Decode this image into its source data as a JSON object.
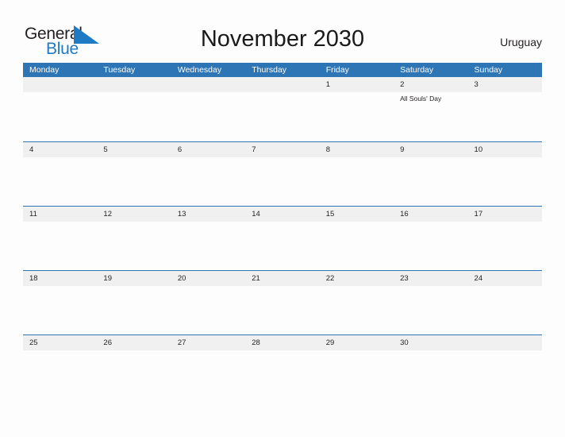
{
  "brand": {
    "name_part1": "General",
    "name_part2": "Blue",
    "mark": "triangle-flag-icon",
    "color_dark": "#231f20",
    "color_blue": "#1f7ac4"
  },
  "header": {
    "title": "November 2030",
    "region": "Uruguay"
  },
  "theme": {
    "header_blue": "#2e75b6",
    "row_band_gray": "#f0f0f0",
    "page_background": "#fdfdfd",
    "text_color": "#231f20"
  },
  "calendar": {
    "month": "November",
    "year": "2030",
    "weekday_headers": [
      "Monday",
      "Tuesday",
      "Wednesday",
      "Thursday",
      "Friday",
      "Saturday",
      "Sunday"
    ],
    "weeks": [
      [
        {
          "date": "",
          "event": ""
        },
        {
          "date": "",
          "event": ""
        },
        {
          "date": "",
          "event": ""
        },
        {
          "date": "",
          "event": ""
        },
        {
          "date": "1",
          "event": ""
        },
        {
          "date": "2",
          "event": "All Souls' Day"
        },
        {
          "date": "3",
          "event": ""
        }
      ],
      [
        {
          "date": "4",
          "event": ""
        },
        {
          "date": "5",
          "event": ""
        },
        {
          "date": "6",
          "event": ""
        },
        {
          "date": "7",
          "event": ""
        },
        {
          "date": "8",
          "event": ""
        },
        {
          "date": "9",
          "event": ""
        },
        {
          "date": "10",
          "event": ""
        }
      ],
      [
        {
          "date": "11",
          "event": ""
        },
        {
          "date": "12",
          "event": ""
        },
        {
          "date": "13",
          "event": ""
        },
        {
          "date": "14",
          "event": ""
        },
        {
          "date": "15",
          "event": ""
        },
        {
          "date": "16",
          "event": ""
        },
        {
          "date": "17",
          "event": ""
        }
      ],
      [
        {
          "date": "18",
          "event": ""
        },
        {
          "date": "19",
          "event": ""
        },
        {
          "date": "20",
          "event": ""
        },
        {
          "date": "21",
          "event": ""
        },
        {
          "date": "22",
          "event": ""
        },
        {
          "date": "23",
          "event": ""
        },
        {
          "date": "24",
          "event": ""
        }
      ],
      [
        {
          "date": "25",
          "event": ""
        },
        {
          "date": "26",
          "event": ""
        },
        {
          "date": "27",
          "event": ""
        },
        {
          "date": "28",
          "event": ""
        },
        {
          "date": "29",
          "event": ""
        },
        {
          "date": "30",
          "event": ""
        },
        {
          "date": "",
          "event": ""
        }
      ]
    ]
  }
}
